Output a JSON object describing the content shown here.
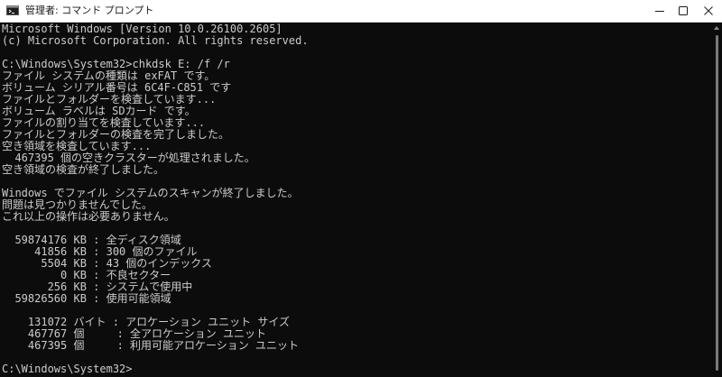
{
  "window": {
    "title": "管理者: コマンド プロンプト",
    "icon": "command-prompt-icon",
    "caption_buttons": [
      "minimize-icon",
      "maximize-icon",
      "close-icon"
    ]
  },
  "console": {
    "lines": [
      "Microsoft Windows [Version 10.0.26100.2605]",
      "(c) Microsoft Corporation. All rights reserved.",
      "",
      "C:\\Windows\\System32>chkdsk E: /f /r",
      "ファイル システムの種類は exFAT です。",
      "ボリューム シリアル番号は 6C4F-C851 です",
      "ファイルとフォルダーを検査しています...",
      "ボリューム ラベルは SDカード です。",
      "ファイルの割り当てを検査しています...",
      "ファイルとフォルダーの検査を完了しました。",
      "空き領域を検査しています...",
      "  467395 個の空きクラスターが処理されました。",
      "空き領域の検査が終了しました。",
      "",
      "Windows でファイル システムのスキャンが終了しました。",
      "問題は見つかりませんでした。",
      "これ以上の操作は必要ありません。",
      "",
      "  59874176 KB : 全ディスク領域",
      "     41856 KB : 300 個のファイル",
      "      5504 KB : 43 個のインデックス",
      "         0 KB : 不良セクター",
      "       256 KB : システムで使用中",
      "  59826560 KB : 使用可能領域",
      "",
      "    131072 バイト : アロケーション ユニット サイズ",
      "    467767 個     : 全アロケーション ユニット",
      "    467395 個     : 利用可能アロケーション ユニット",
      "",
      "C:\\Windows\\System32>"
    ]
  },
  "colors": {
    "console_background": "#0c0c0c",
    "console_text": "#cccccc",
    "titlebar_background": "#ffffff"
  }
}
